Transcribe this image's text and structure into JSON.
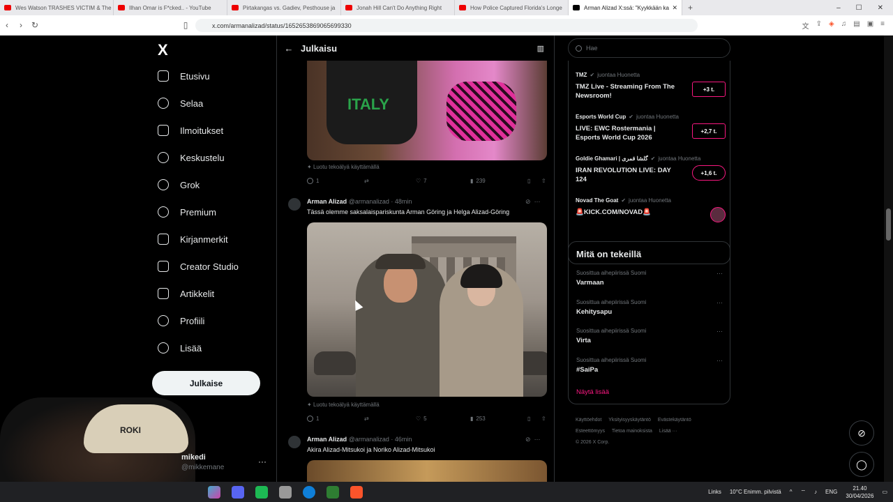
{
  "browser": {
    "tabs": [
      {
        "label": "Wes Watson TRASHES VICTIM & The"
      },
      {
        "label": "Ilhan Omar is F*cked.. - YouTube"
      },
      {
        "label": "Pirtakangas vs. Gadiev, Pesthouse ja"
      },
      {
        "label": "Jonah Hill Can't Do Anything Right"
      },
      {
        "label": "How Police Captured Florida's Longe"
      },
      {
        "label": "Arman Alizad X:ssä: \"Kyykkään ka"
      }
    ],
    "new_tab": "+",
    "url": "x.com/armanalizad/status/1652653869065699330"
  },
  "nav": {
    "logo": "X",
    "items": [
      {
        "label": "Etusivu",
        "icon": "home-icon"
      },
      {
        "label": "Selaa",
        "icon": "search-icon"
      },
      {
        "label": "Ilmoitukset",
        "icon": "bell-icon"
      },
      {
        "label": "Keskustelu",
        "icon": "chat-icon"
      },
      {
        "label": "Grok",
        "icon": "grok-icon"
      },
      {
        "label": "Premium",
        "icon": "verified-icon"
      },
      {
        "label": "Kirjanmerkit",
        "icon": "bookmark-icon"
      },
      {
        "label": "Creator Studio",
        "icon": "rocket-icon"
      },
      {
        "label": "Artikkelit",
        "icon": "article-icon"
      },
      {
        "label": "Profiili",
        "icon": "person-icon"
      },
      {
        "label": "Lisää",
        "icon": "more-circle-icon"
      }
    ],
    "post_button": "Julkaise",
    "account": {
      "name": "mikedi",
      "handle": "@mikkemane",
      "more": "···"
    },
    "webcam_text": "ROKI"
  },
  "center": {
    "header_title": "Julkaisu",
    "tweet1": {
      "ai_label": "Luotu tekoälyä käyttämällä",
      "replies": "1",
      "likes": "7",
      "views": "239"
    },
    "tweet2": {
      "name": "Arman Alizad",
      "handle": "@armanalizad · 48min",
      "text": "Tässä olemme saksalaispariskunta Arman Göring ja Helga Alizad-Göring",
      "ai_label": "Luotu tekoälyä käyttämällä",
      "replies": "1",
      "likes": "5",
      "views": "253"
    },
    "tweet3": {
      "name": "Arman Alizad",
      "handle": "@armanalizad · 46min",
      "text": "Akira Alizad-Mitsukoi ja Noriko Alizad-Mitsukoi"
    }
  },
  "right": {
    "search_placeholder": "Hae",
    "live": [
      {
        "who": "TMZ",
        "suffix": "juontaa Huonetta",
        "title": "TMZ Live - Streaming From The Newsroom!",
        "badge": "+3 t."
      },
      {
        "who": "Esports World Cup",
        "suffix": "juontaa Huonetta",
        "title": "LIVE: EWC Rostermania | Esports World Cup 2026",
        "badge": "+2,7 t."
      },
      {
        "who": "Goldie Ghamari | گلشا قمری",
        "suffix": "juontaa Huonetta",
        "title": "IRAN REVOLUTION LIVE: DAY 124",
        "badge": "+1,6 t."
      },
      {
        "who": "Novad The Goat",
        "suffix": "juontaa Huonetta",
        "title": "🚨KICK.COM/NOVAD🚨",
        "badge": ""
      }
    ],
    "trends_title": "Mitä on tekeillä",
    "trends": [
      {
        "context": "Suosittua aihepiirissä Suomi",
        "name": "Varmaan"
      },
      {
        "context": "Suosittua aihepiirissä Suomi",
        "name": "Kehitysapu"
      },
      {
        "context": "Suosittua aihepiirissä Suomi",
        "name": "Virta"
      },
      {
        "context": "Suosittua aihepiirissä Suomi",
        "name": "#SaiPa"
      }
    ],
    "show_more": "Näytä lisää",
    "footer": [
      "Käyttöehdot",
      "Yksityisyyskäytäntö",
      "Evästekäytäntö",
      "Esteettömyys",
      "Tietoa mainoksista",
      "Lisää ···",
      "© 2026 X Corp."
    ]
  },
  "taskbar": {
    "links": "Links",
    "weather": "10°C  Enimm. pilvistä",
    "lang": "ENG",
    "time": "21.40",
    "date": "30/04/2026"
  }
}
